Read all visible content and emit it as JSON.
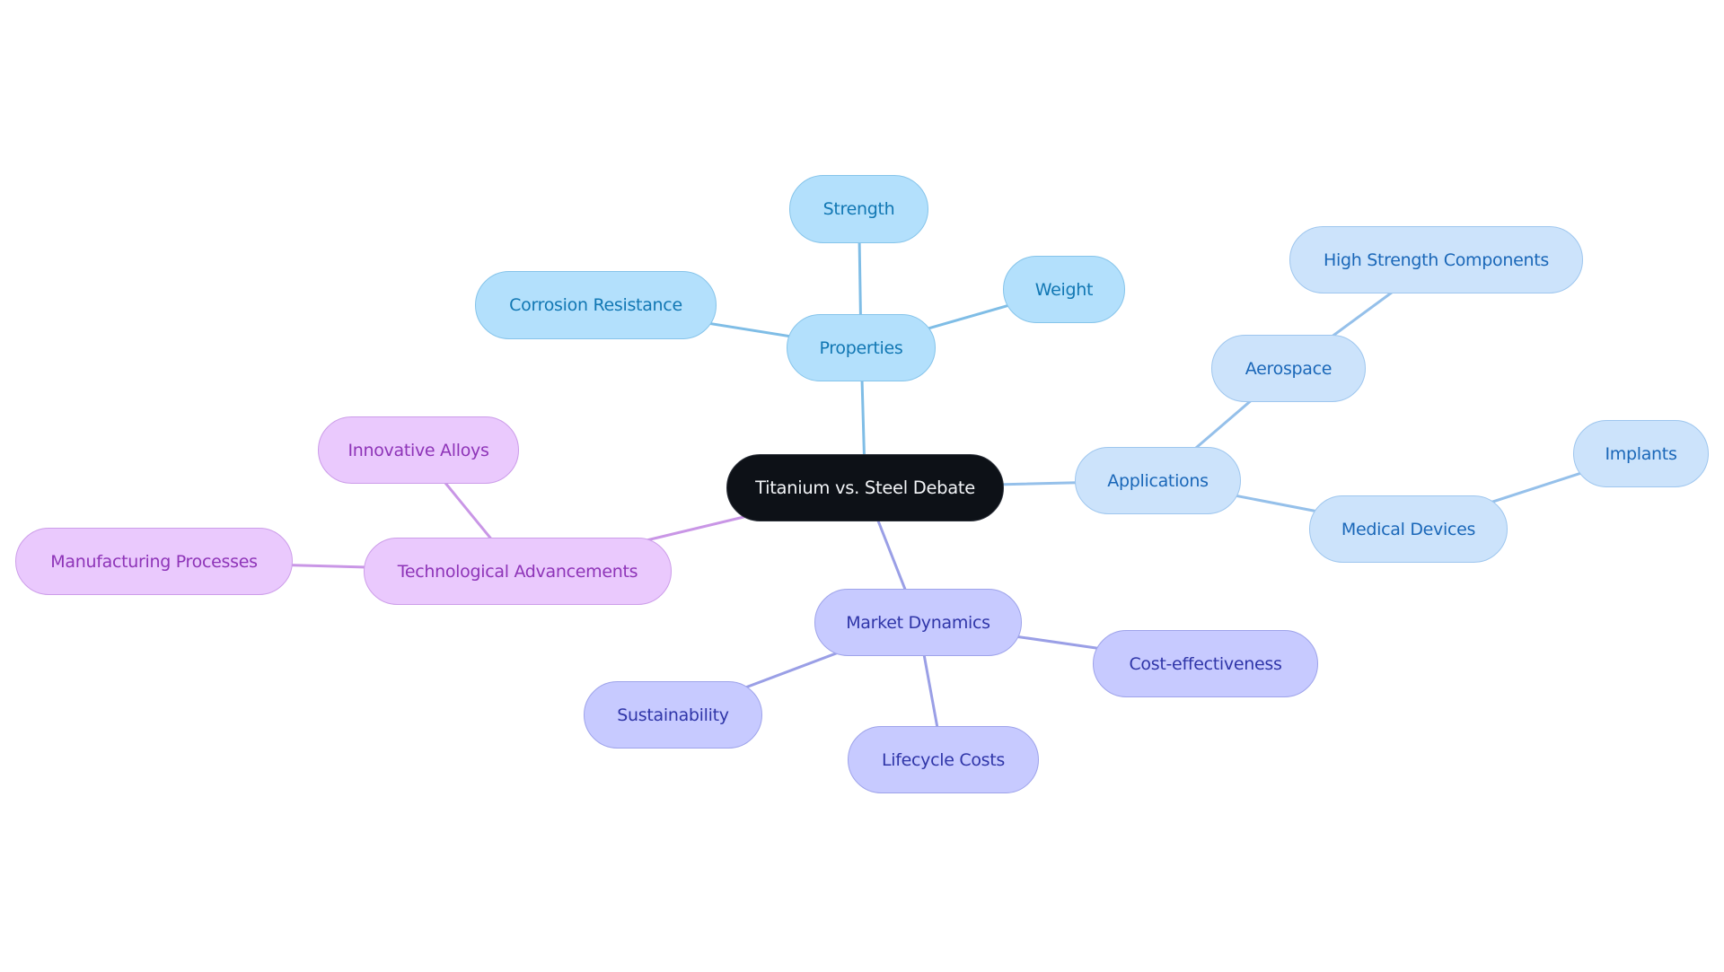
{
  "title": "Titanium vs. Steel Debate",
  "colors": {
    "root_bg": "#0d1117",
    "properties": "#b3e0fc",
    "applications": "#cce3fb",
    "market": "#c7caff",
    "tech": "#eac9fd",
    "edge_properties": "#7fbde6",
    "edge_applications": "#95c0ea",
    "edge_market": "#9a9fe6",
    "edge_tech": "#c996e6"
  },
  "nodes": {
    "root": {
      "label": "Titanium vs. Steel Debate",
      "branch": "root"
    },
    "properties": {
      "label": "Properties",
      "branch": "properties",
      "parent": "root"
    },
    "strength": {
      "label": "Strength",
      "branch": "properties",
      "parent": "properties"
    },
    "corrosion": {
      "label": "Corrosion Resistance",
      "branch": "properties",
      "parent": "properties"
    },
    "weight": {
      "label": "Weight",
      "branch": "properties",
      "parent": "properties"
    },
    "applications": {
      "label": "Applications",
      "branch": "applications",
      "parent": "root"
    },
    "aerospace": {
      "label": "Aerospace",
      "branch": "applications",
      "parent": "applications"
    },
    "high_strength": {
      "label": "High Strength Components",
      "branch": "applications",
      "parent": "aerospace"
    },
    "medical": {
      "label": "Medical Devices",
      "branch": "applications",
      "parent": "applications"
    },
    "implants": {
      "label": "Implants",
      "branch": "applications",
      "parent": "medical"
    },
    "market": {
      "label": "Market Dynamics",
      "branch": "market",
      "parent": "root"
    },
    "cost": {
      "label": "Cost-effectiveness",
      "branch": "market",
      "parent": "market"
    },
    "lifecycle": {
      "label": "Lifecycle Costs",
      "branch": "market",
      "parent": "market"
    },
    "sustainability": {
      "label": "Sustainability",
      "branch": "market",
      "parent": "market"
    },
    "tech": {
      "label": "Technological Advancements",
      "branch": "tech",
      "parent": "root"
    },
    "alloys": {
      "label": "Innovative Alloys",
      "branch": "tech",
      "parent": "tech"
    },
    "manufacturing": {
      "label": "Manufacturing Processes",
      "branch": "tech",
      "parent": "tech"
    }
  }
}
